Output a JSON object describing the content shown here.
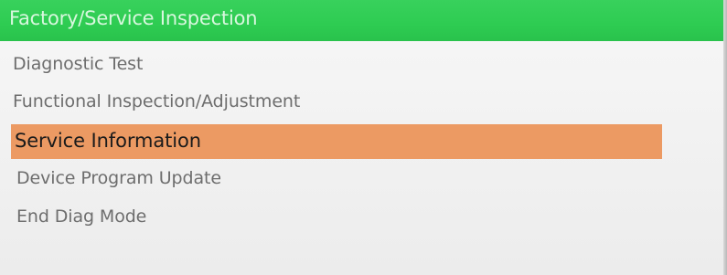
{
  "header": {
    "title": "Factory/Service Inspection"
  },
  "menu": {
    "items": [
      {
        "label": "Diagnostic Test",
        "selected": false
      },
      {
        "label": "Functional Inspection/Adjustment",
        "selected": false
      },
      {
        "label": "Service Information",
        "selected": true
      },
      {
        "label": "Device Program Update",
        "selected": false
      },
      {
        "label": "End Diag Mode",
        "selected": false
      }
    ]
  },
  "colors": {
    "header_background": "#2ecc52",
    "header_text": "#d8f7de",
    "selection_highlight": "#ec9a63",
    "item_text": "#6d6d6d",
    "selected_text": "#1b1b1b",
    "screen_background": "#f2f2f2"
  }
}
